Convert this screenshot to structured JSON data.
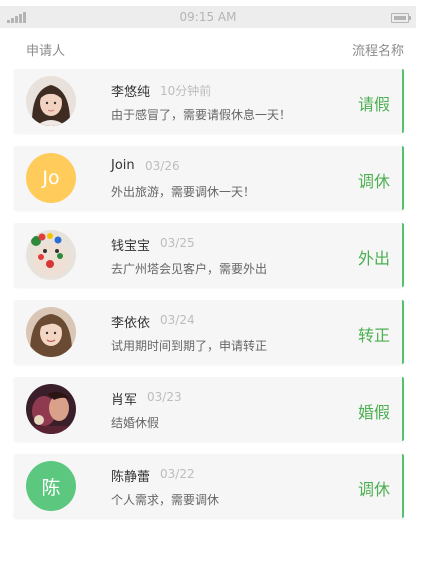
{
  "status_bar": {
    "time": "09:15 AM"
  },
  "header": {
    "applicant_label": "申请人",
    "process_label": "流程名称"
  },
  "requests": [
    {
      "name": "李悠纯",
      "time": "10分钟前",
      "description": "由于感冒了，需要请假休息一天！",
      "process": "请假",
      "avatar_kind": "photo-woman",
      "avatar_text": ""
    },
    {
      "name": "Join",
      "time": "03/26",
      "description": "外出旅游，需要调休一天！",
      "process": "调休",
      "avatar_kind": "initials",
      "avatar_text": "Jo",
      "avatar_color": "#ffcc5c"
    },
    {
      "name": "钱宝宝",
      "time": "03/25",
      "description": "去广州塔会见客户，需要外出",
      "process": "外出",
      "avatar_kind": "photo-facepaint",
      "avatar_text": ""
    },
    {
      "name": "李依依",
      "time": "03/24",
      "description": "试用期时间到期了，申请转正",
      "process": "转正",
      "avatar_kind": "photo-woman2",
      "avatar_text": ""
    },
    {
      "name": "肖军",
      "time": "03/23",
      "description": "结婚休假",
      "process": "婚假",
      "avatar_kind": "photo-couple",
      "avatar_text": ""
    },
    {
      "name": "陈静蕾",
      "time": "03/22",
      "description": "个人需求，需要调休",
      "process": "调休",
      "avatar_kind": "initials",
      "avatar_text": "陈",
      "avatar_color": "#5cc87f"
    }
  ]
}
